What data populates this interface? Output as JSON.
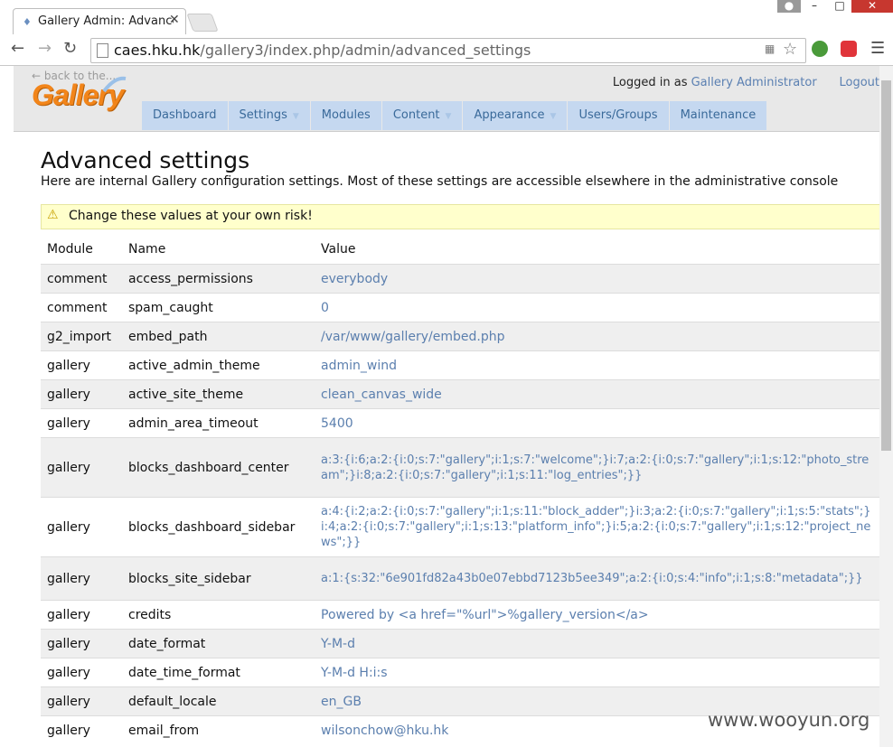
{
  "browser": {
    "tab_title": "Gallery Admin: Advance",
    "url_host": "caes.hku.hk",
    "url_path": "/gallery3/index.php/admin/advanced_settings"
  },
  "header": {
    "back_link": "← back to the...",
    "logo_text": "Gallery",
    "logged_in_prefix": "Logged in as",
    "user_name": "Gallery Administrator",
    "logout_label": "Logout"
  },
  "nav": [
    {
      "label": "Dashboard",
      "dropdown": false
    },
    {
      "label": "Settings",
      "dropdown": true
    },
    {
      "label": "Modules",
      "dropdown": false
    },
    {
      "label": "Content",
      "dropdown": true
    },
    {
      "label": "Appearance",
      "dropdown": true
    },
    {
      "label": "Users/Groups",
      "dropdown": false
    },
    {
      "label": "Maintenance",
      "dropdown": false
    }
  ],
  "main": {
    "title": "Advanced settings",
    "intro": "Here are internal Gallery configuration settings. Most of these settings are accessible elsewhere in the administrative console",
    "warning": "Change these values at your own risk!",
    "columns": [
      "Module",
      "Name",
      "Value"
    ],
    "rows": [
      {
        "module": "comment",
        "name": "access_permissions",
        "value": "everybody"
      },
      {
        "module": "comment",
        "name": "spam_caught",
        "value": "0"
      },
      {
        "module": "g2_import",
        "name": "embed_path",
        "value": "/var/www/gallery/embed.php"
      },
      {
        "module": "gallery",
        "name": "active_admin_theme",
        "value": "admin_wind"
      },
      {
        "module": "gallery",
        "name": "active_site_theme",
        "value": "clean_canvas_wide"
      },
      {
        "module": "gallery",
        "name": "admin_area_timeout",
        "value": "5400"
      },
      {
        "module": "gallery",
        "name": "blocks_dashboard_center",
        "value": "a:3:{i:6;a:2:{i:0;s:7:\"gallery\";i:1;s:7:\"welcome\";}i:7;a:2:{i:0;s:7:\"gallery\";i:1;s:12:\"photo_stream\";}i:8;a:2:{i:0;s:7:\"gallery\";i:1;s:11:\"log_entries\";}}"
      },
      {
        "module": "gallery",
        "name": "blocks_dashboard_sidebar",
        "value": "a:4:{i:2;a:2:{i:0;s:7:\"gallery\";i:1;s:11:\"block_adder\";}i:3;a:2:{i:0;s:7:\"gallery\";i:1;s:5:\"stats\";}i:4;a:2:{i:0;s:7:\"gallery\";i:1;s:13:\"platform_info\";}i:5;a:2:{i:0;s:7:\"gallery\";i:1;s:12:\"project_news\";}}"
      },
      {
        "module": "gallery",
        "name": "blocks_site_sidebar",
        "value": "a:1:{s:32:\"6e901fd82a43b0e07ebbd7123b5ee349\";a:2:{i:0;s:4:\"info\";i:1;s:8:\"metadata\";}}"
      },
      {
        "module": "gallery",
        "name": "credits",
        "value": "Powered by <a href=\"%url\">%gallery_version</a>"
      },
      {
        "module": "gallery",
        "name": "date_format",
        "value": "Y-M-d"
      },
      {
        "module": "gallery",
        "name": "date_time_format",
        "value": "Y-M-d H:i:s"
      },
      {
        "module": "gallery",
        "name": "default_locale",
        "value": "en_GB"
      },
      {
        "module": "gallery",
        "name": "email_from",
        "value": "wilsonchow@hku.hk"
      }
    ]
  },
  "watermark": "www.wooyun.org",
  "colors": {
    "nav_bg": "#c5d8f0",
    "link": "#5b80b2",
    "warning_bg": "#ffffcc",
    "logo": "#f2851a"
  }
}
